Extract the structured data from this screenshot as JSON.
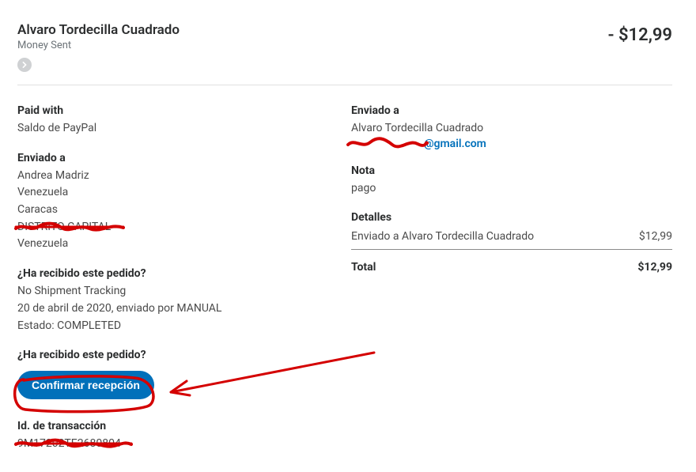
{
  "header": {
    "recipient_name": "Alvaro Tordecilla Cuadrado",
    "subtitle": "Money Sent",
    "amount_display": "- $12,99"
  },
  "left": {
    "paid_with_title": "Paid with",
    "paid_with_value": "Saldo de PayPal",
    "shipped_to_title": "Enviado a",
    "shipped_to_lines": {
      "l1": "Andrea Madriz",
      "l2": "Venezuela",
      "l3": "Caracas",
      "l4_redacted": "DISTRITO CAPITAL",
      "l5": "Venezuela"
    },
    "received_q1": "¿Ha recibido este pedido?",
    "tracking_line1": "No Shipment Tracking",
    "tracking_line2": "20 de abril de 2020, enviado por MANUAL",
    "tracking_line3": "Estado: COMPLETED",
    "received_q2": "¿Ha recibido este pedido?",
    "confirm_button": "Confirmar recepción",
    "txn_title": "Id. de transacción",
    "txn_id_redacted": "9M17202TE2680804"
  },
  "right": {
    "sent_to_title": "Enviado a",
    "sent_to_name": "Alvaro Tordecilla Cuadrado",
    "sent_to_email_suffix": "@gmail.com",
    "note_title": "Nota",
    "note_value": "pago",
    "detalles_title": "Detalles",
    "detail_label": "Enviado a Alvaro Tordecilla Cuadrado",
    "detail_amount": "$12,99",
    "total_label": "Total",
    "total_amount": "$12,99"
  },
  "colors": {
    "accent": "#0070ba",
    "annotation": "#d40000"
  }
}
